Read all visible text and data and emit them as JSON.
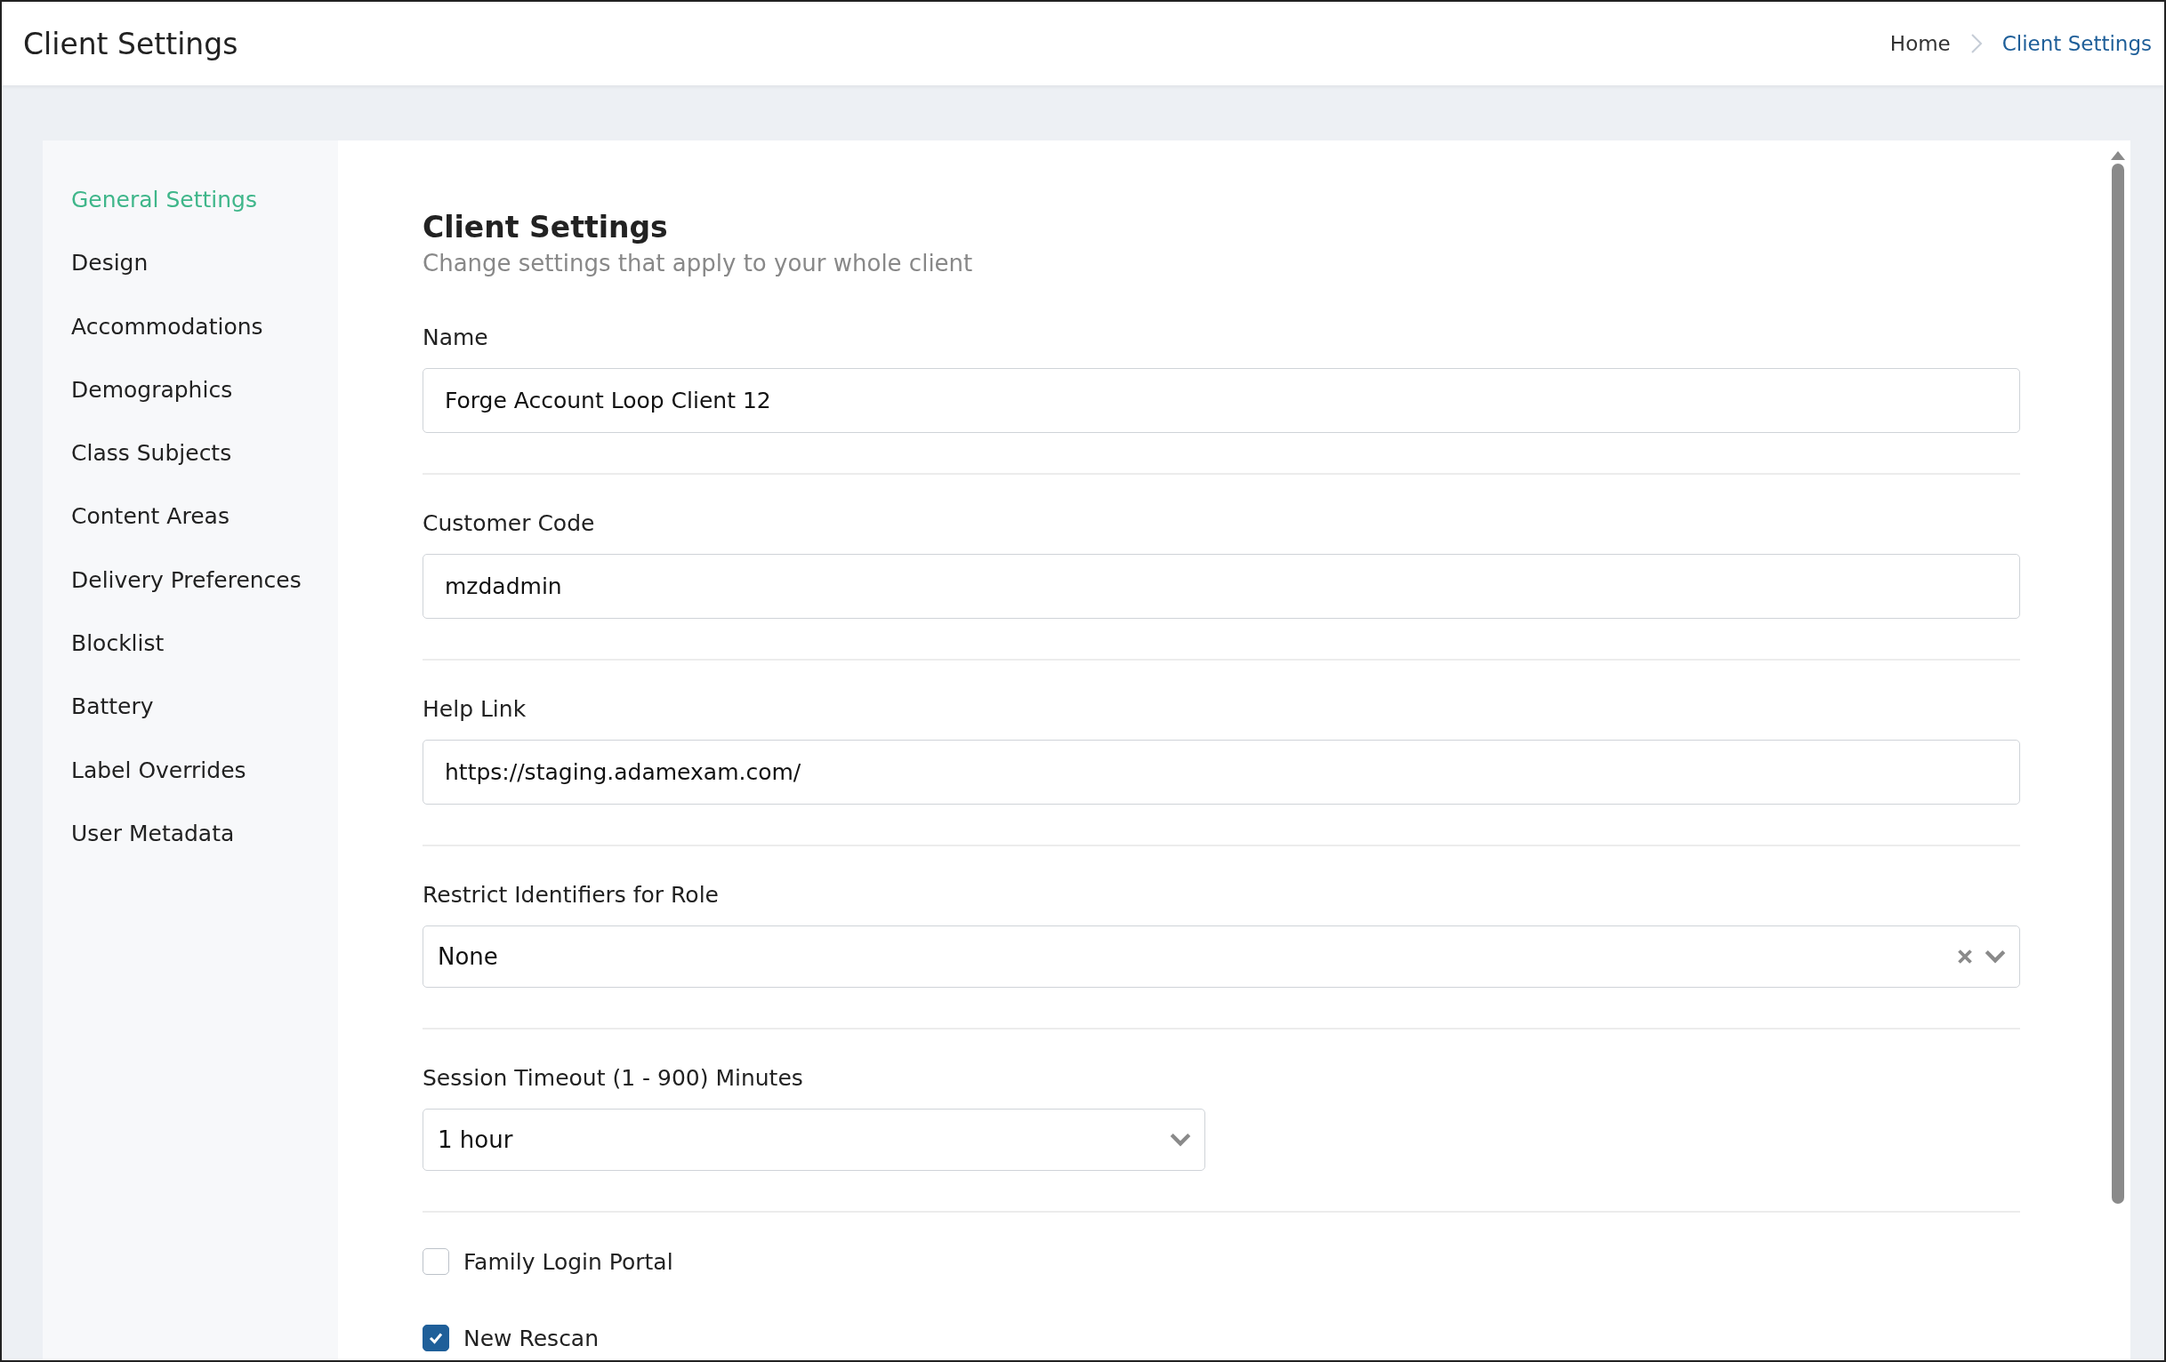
{
  "header": {
    "title": "Client Settings",
    "breadcrumb": [
      {
        "label": "Home",
        "selected": false
      },
      {
        "label": "Client Settings",
        "selected": true
      }
    ]
  },
  "sidebar": {
    "items": [
      {
        "label": "General Settings",
        "selected": true
      },
      {
        "label": "Design",
        "selected": false
      },
      {
        "label": "Accommodations",
        "selected": false
      },
      {
        "label": "Demographics",
        "selected": false
      },
      {
        "label": "Class Subjects",
        "selected": false
      },
      {
        "label": "Content Areas",
        "selected": false
      },
      {
        "label": "Delivery Preferences",
        "selected": false
      },
      {
        "label": "Blocklist",
        "selected": false
      },
      {
        "label": "Battery",
        "selected": false
      },
      {
        "label": "Label Overrides",
        "selected": false
      },
      {
        "label": "User Metadata",
        "selected": false
      }
    ]
  },
  "form": {
    "title": "Client Settings",
    "subtitle": "Change settings that apply to your whole client",
    "fields": [
      {
        "kind": "text",
        "label": "Name",
        "value": "Forge Account Loop Client 12"
      },
      {
        "kind": "text",
        "label": "Customer Code",
        "value": "mzdadmin"
      },
      {
        "kind": "text",
        "label": "Help Link",
        "value": "https://staging.adamexam.com/"
      },
      {
        "kind": "multiselect",
        "label": "Restrict Identifiers for Role",
        "value": "None"
      },
      {
        "kind": "select",
        "label": "Session Timeout (1 - 900) Minutes",
        "value": "1 hour"
      },
      {
        "kind": "checkbox",
        "label": "Family Login Portal",
        "checked": false
      },
      {
        "kind": "checkbox",
        "label": "New Rescan",
        "checked": true
      }
    ]
  }
}
